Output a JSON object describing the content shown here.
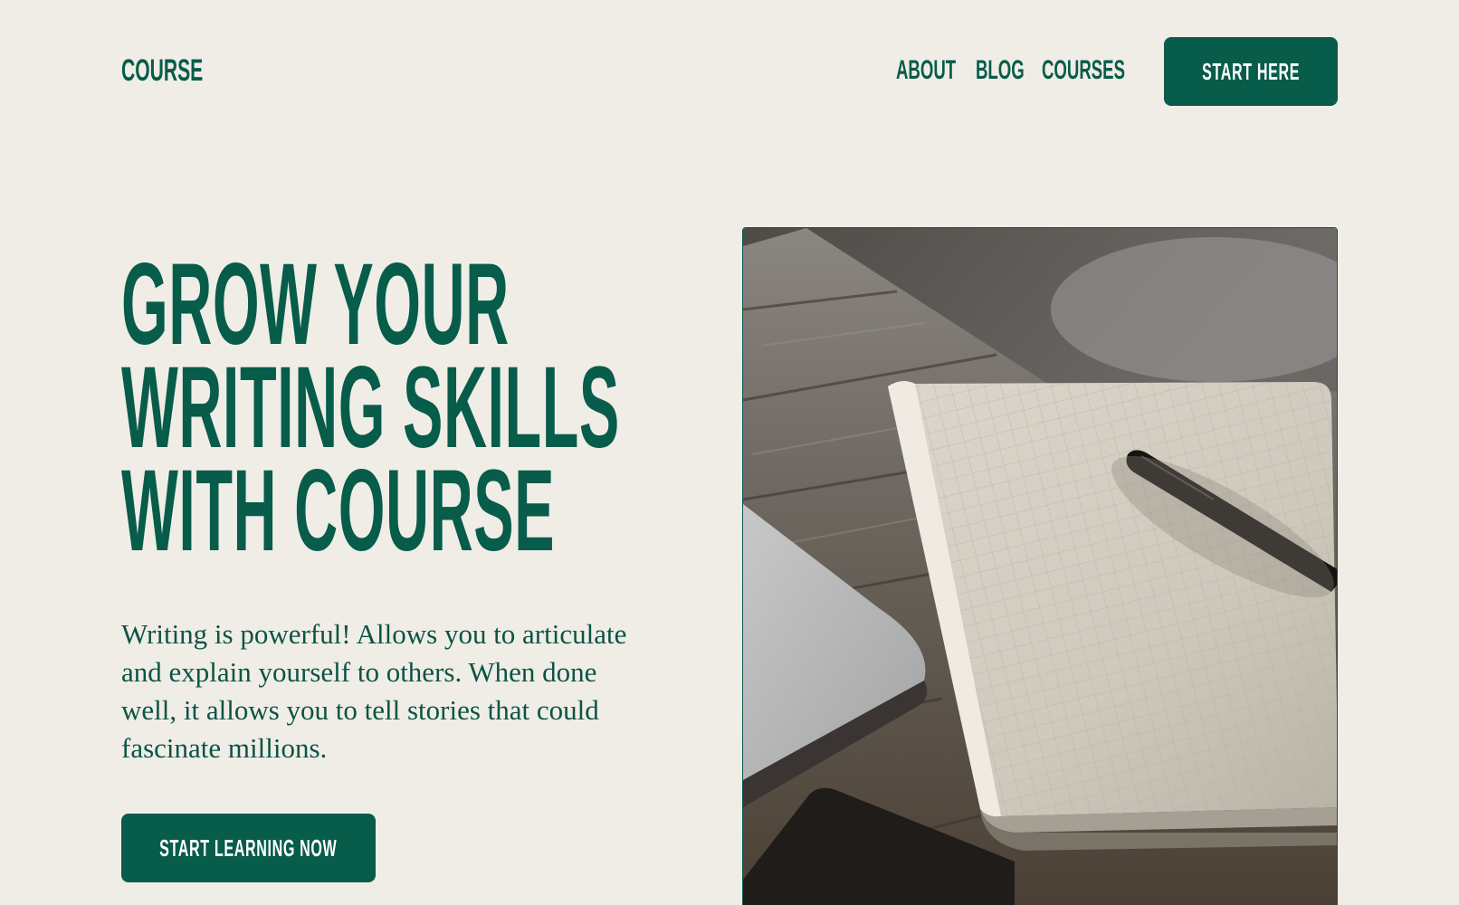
{
  "header": {
    "brand": "COURSE",
    "nav": [
      "ABOUT",
      "BLOG",
      "COURSES"
    ],
    "cta_label": "START HERE"
  },
  "hero": {
    "title_lines": [
      "GROW YOUR",
      "WRITING SKILLS",
      "WITH COURSE"
    ],
    "description": "Writing is powerful! Allows you to articulate and explain yourself to others. When done well, it allows you to tell stories that could fascinate millions.",
    "cta_label": "START LEARNING NOW"
  },
  "colors": {
    "background": "#f0ede6",
    "accent": "#075c4a",
    "button_text": "#ffffff"
  }
}
